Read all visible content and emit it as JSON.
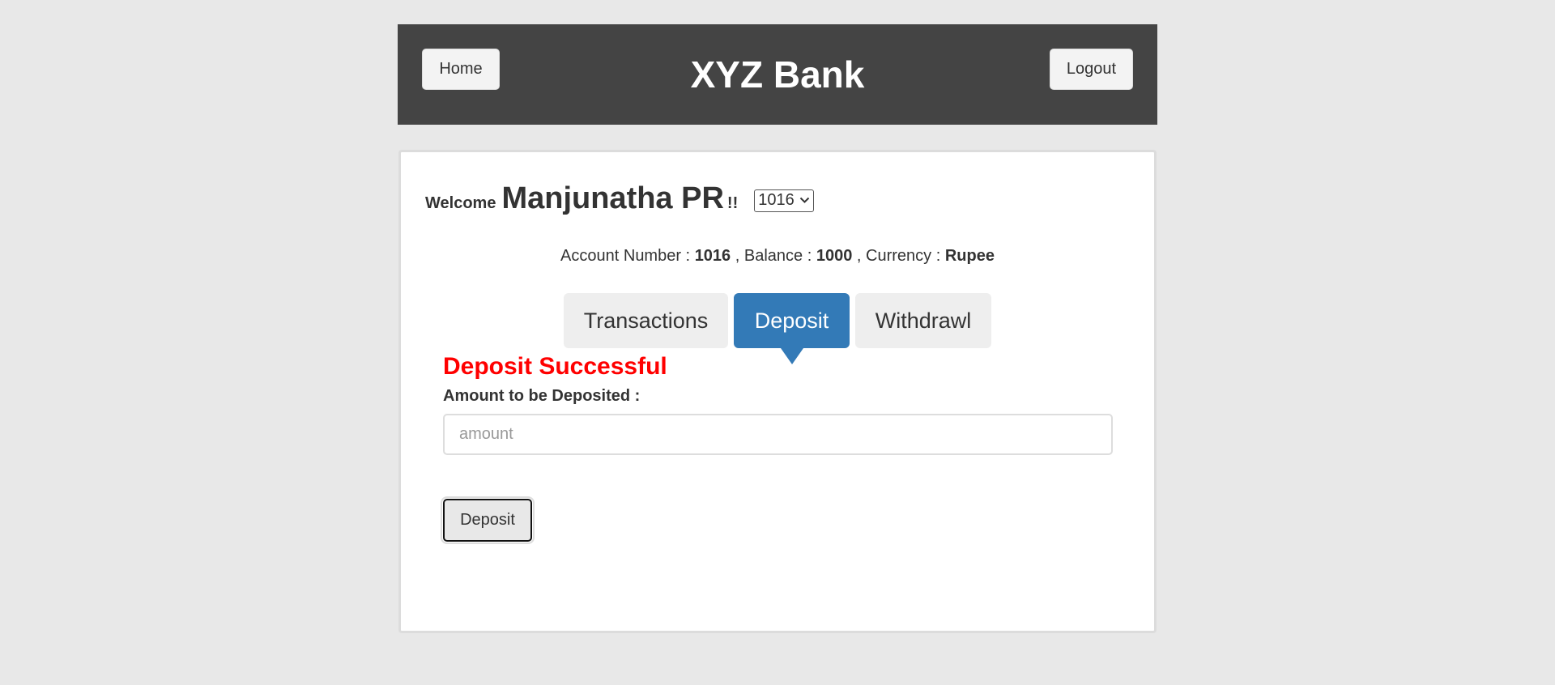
{
  "header": {
    "home_label": "Home",
    "title": "XYZ Bank",
    "logout_label": "Logout"
  },
  "welcome": {
    "label": "Welcome",
    "user_name": "Manjunatha PR",
    "exclaim": "!!",
    "selected_account": "1016"
  },
  "account_info": {
    "account_number_label": "Account Number :",
    "account_number": "1016",
    "balance_label": ", Balance :",
    "balance": "1000",
    "currency_label": ", Currency :",
    "currency": "Rupee"
  },
  "tabs": [
    {
      "label": "Transactions"
    },
    {
      "label": "Deposit"
    },
    {
      "label": "Withdrawl"
    }
  ],
  "deposit_form": {
    "message": "Deposit Successful",
    "amount_label": "Amount to be Deposited :",
    "amount_placeholder": "amount",
    "submit_label": "Deposit"
  },
  "colors": {
    "header_bg": "#444444",
    "active_tab": "#337ab7",
    "success_message": "#ff0000"
  },
  "icons": {
    "select_indicator": "chevron-down-icon"
  }
}
